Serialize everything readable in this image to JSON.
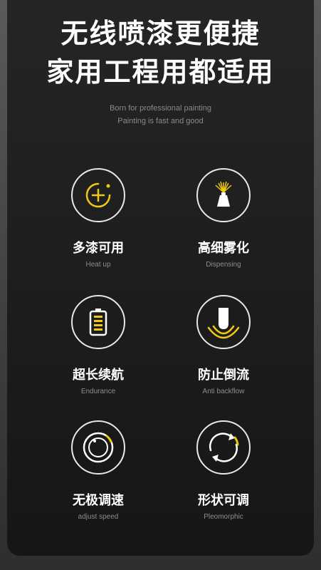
{
  "header": {
    "title_line1": "无线喷漆更便捷",
    "title_line2": "家用工程用都适用",
    "subtitle_line1": "Born for professional painting",
    "subtitle_line2": "Painting is fast and good"
  },
  "colors": {
    "accent": "#f2c811",
    "icon_stroke": "#e8e8e8",
    "background": "#1e1e1e"
  },
  "features": [
    {
      "icon": "plus-circle-icon",
      "title": "多漆可用",
      "subtitle": "Heat up"
    },
    {
      "icon": "spray-bottle-icon",
      "title": "高细雾化",
      "subtitle": "Dispensing"
    },
    {
      "icon": "battery-icon",
      "title": "超长续航",
      "subtitle": "Endurance"
    },
    {
      "icon": "nozzle-icon",
      "title": "防止倒流",
      "subtitle": "Anti backflow"
    },
    {
      "icon": "speed-dial-icon",
      "title": "无极调速",
      "subtitle": "adjust speed"
    },
    {
      "icon": "rotate-arrows-icon",
      "title": "形状可调",
      "subtitle": "Pleomorphic"
    }
  ]
}
